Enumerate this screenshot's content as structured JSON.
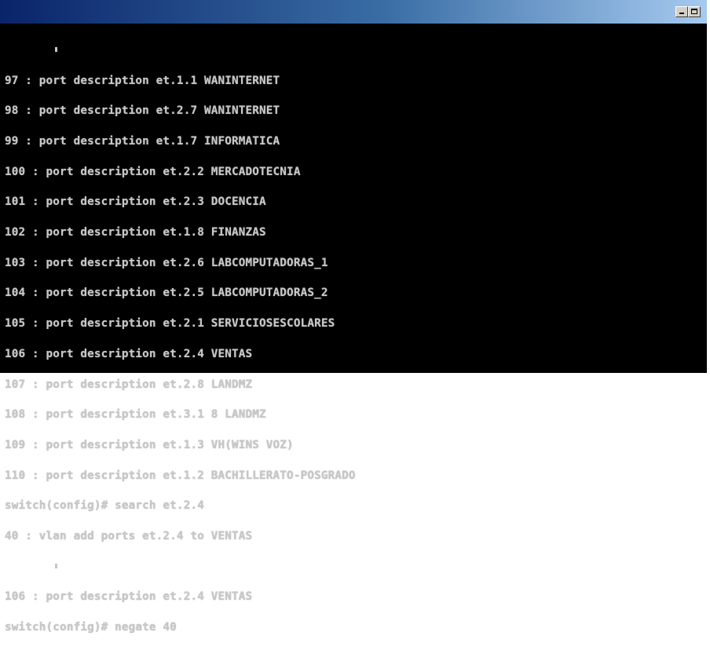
{
  "window": {
    "title": "",
    "controls": {
      "minimize": "minimize",
      "maximize": "maximize"
    }
  },
  "console": {
    "lines": [
      "97 : port description et.1.1 WANINTERNET",
      "98 : port description et.2.7 WANINTERNET",
      "99 : port description et.1.7 INFORMATICA",
      "100 : port description et.2.2 MERCADOTECNIA",
      "101 : port description et.2.3 DOCENCIA",
      "102 : port description et.1.8 FINANZAS",
      "103 : port description et.2.6 LABCOMPUTADORAS_1",
      "104 : port description et.2.5 LABCOMPUTADORAS_2",
      "105 : port description et.2.1 SERVICIOSESCOLARES",
      "106 : port description et.2.4 VENTAS",
      "107 : port description et.2.8 LANDMZ",
      "108 : port description et.3.1 8 LANDMZ",
      "109 : port description et.1.3 VH(WINS VOZ)",
      "110 : port description et.1.2 BACHILLERATO-POSGRADO",
      "switch(config)# search et.2.4",
      "40 : vlan add ports et.2.4 to VENTAS",
      "",
      "106 : port description et.2.4 VENTAS",
      "switch(config)# negate 40"
    ]
  }
}
